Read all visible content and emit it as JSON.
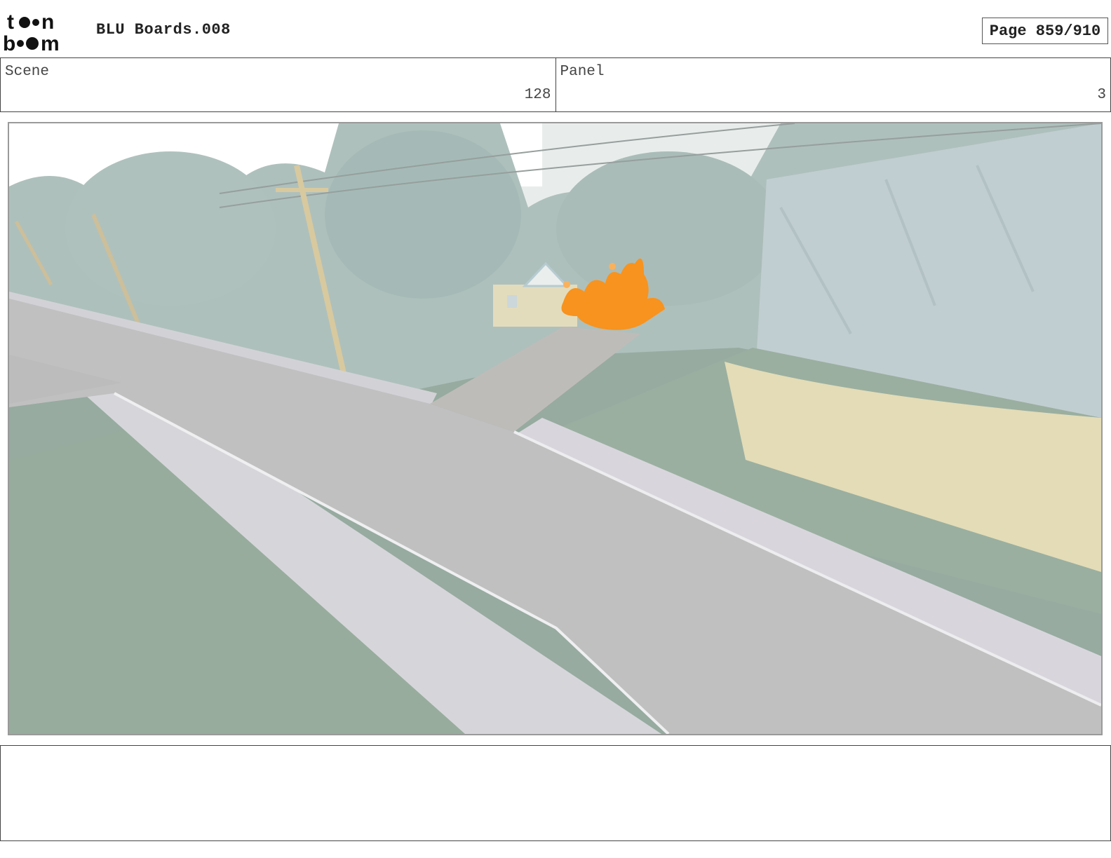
{
  "header": {
    "logo_text": "toon boom",
    "document_title": "BLU Boards.008",
    "page_label": "Page 859/910"
  },
  "info": {
    "scene_label": "Scene",
    "scene_value": "128",
    "panel_label": "Panel",
    "panel_value": "3"
  },
  "panel_image": {
    "description_icon": "storyboard-panel-street-scene",
    "accent_color": "#f7931e"
  },
  "notes": {
    "text": ""
  }
}
